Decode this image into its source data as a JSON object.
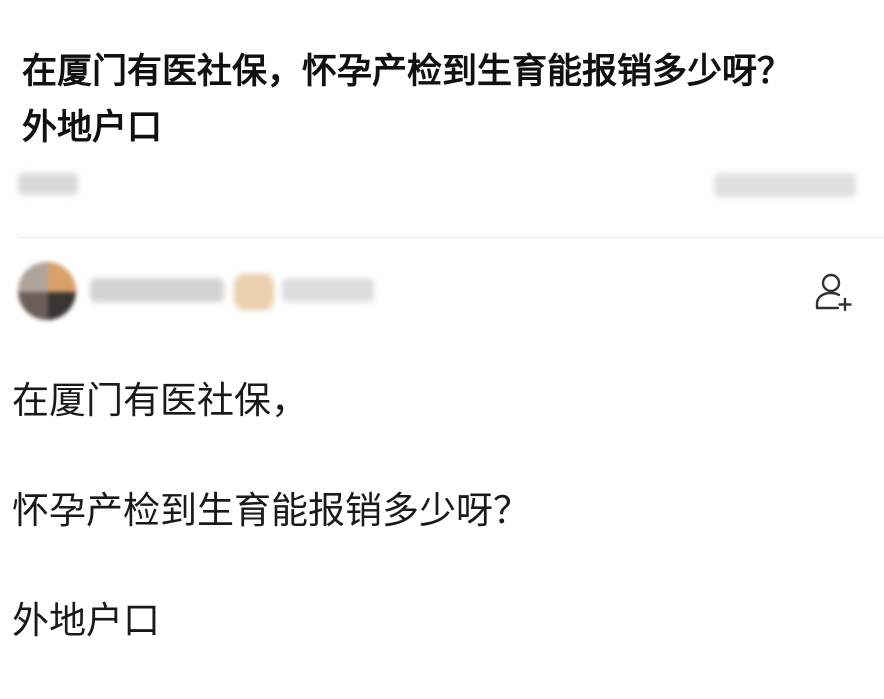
{
  "question": {
    "title": "在厦门有医社保，怀孕产检到生育能报销多少呀？外地户口"
  },
  "meta": {
    "left_text": "",
    "right_text": ""
  },
  "author": {
    "name": "",
    "badge": ""
  },
  "actions": {
    "follow_icon": "add-user-icon"
  },
  "content": {
    "paragraphs": [
      "在厦门有医社保，",
      "怀孕产检到生育能报销多少呀？",
      "外地户口"
    ]
  }
}
